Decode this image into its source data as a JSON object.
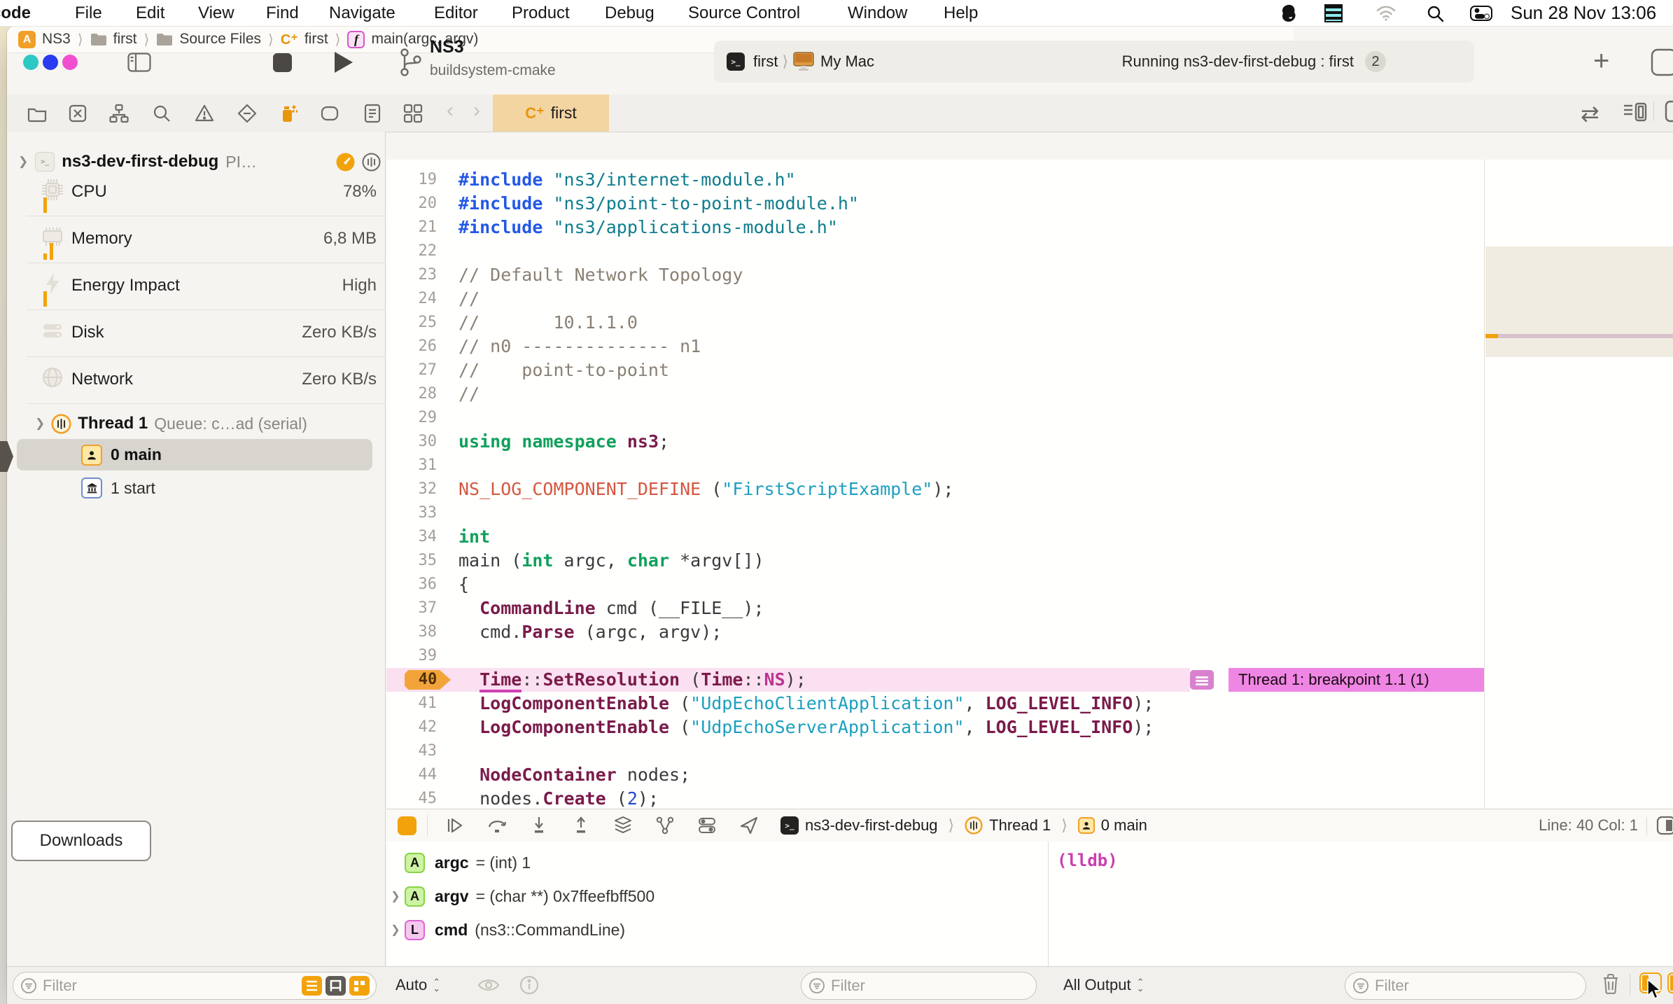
{
  "menu_bar": {
    "app": "Xcode",
    "items": [
      "File",
      "Edit",
      "View",
      "Find",
      "Navigate",
      "Editor",
      "Product",
      "Debug",
      "Source Control",
      "Window",
      "Help"
    ],
    "clock": "Sun 28 Nov 13:06"
  },
  "toolbar": {
    "project": "NS3",
    "build_system": "buildsystem-cmake",
    "scheme": "first",
    "destination": "My Mac",
    "activity": "Running ns3-dev-first-debug : first",
    "activity_count": "2"
  },
  "tab_bar": {
    "active_tab": "first",
    "tab_icon": "C⁺"
  },
  "jump_bar": {
    "segments": [
      {
        "icon": "app",
        "label": "NS3"
      },
      {
        "icon": "folder",
        "label": "first"
      },
      {
        "icon": "folder",
        "label": "Source Files"
      },
      {
        "icon": "cpp",
        "label": "first"
      },
      {
        "icon": "func",
        "label": "main(argc, argv)"
      }
    ]
  },
  "navigator": {
    "process": {
      "name": "ns3-dev-first-debug",
      "pid": "PI…"
    },
    "gauges": [
      {
        "label": "CPU",
        "value": "78%",
        "icon": "cpu",
        "ticks": [
          22
        ]
      },
      {
        "label": "Memory",
        "value": "6,8 MB",
        "icon": "memory",
        "ticks": [
          9,
          24
        ]
      },
      {
        "label": "Energy Impact",
        "value": "High",
        "icon": "energy",
        "ticks": [
          22
        ]
      },
      {
        "label": "Disk",
        "value": "Zero KB/s",
        "icon": "disk",
        "ticks": []
      },
      {
        "label": "Network",
        "value": "Zero KB/s",
        "icon": "network",
        "ticks": []
      }
    ],
    "thread": {
      "name": "Thread 1",
      "queue": "Queue: c…ad (serial)",
      "frames": [
        {
          "icon": "person",
          "label": "0 main",
          "selected": true
        },
        {
          "icon": "bank",
          "label": "1 start",
          "selected": false
        }
      ]
    },
    "downloads": "Downloads",
    "filter_placeholder": "Filter"
  },
  "editor": {
    "breakpoint": {
      "line": "40",
      "banner": "Thread 1: breakpoint 1.1 (1)"
    },
    "lines": [
      {
        "n": "19",
        "t": [
          [
            "pp",
            "#include"
          ],
          [
            "pl",
            " "
          ],
          [
            "si",
            "\"ns3/internet-module.h\""
          ]
        ]
      },
      {
        "n": "20",
        "t": [
          [
            "pp",
            "#include"
          ],
          [
            "pl",
            " "
          ],
          [
            "si",
            "\"ns3/point-to-point-module.h\""
          ]
        ]
      },
      {
        "n": "21",
        "t": [
          [
            "pp",
            "#include"
          ],
          [
            "pl",
            " "
          ],
          [
            "si",
            "\"ns3/applications-module.h\""
          ]
        ]
      },
      {
        "n": "22",
        "t": []
      },
      {
        "n": "23",
        "t": [
          [
            "cm",
            "// Default Network Topology"
          ]
        ]
      },
      {
        "n": "24",
        "t": [
          [
            "cm",
            "//"
          ]
        ]
      },
      {
        "n": "25",
        "t": [
          [
            "cm",
            "//       10.1.1.0"
          ]
        ]
      },
      {
        "n": "26",
        "t": [
          [
            "cm",
            "// n0 -------------- n1"
          ]
        ]
      },
      {
        "n": "27",
        "t": [
          [
            "cm",
            "//    point-to-point"
          ]
        ]
      },
      {
        "n": "28",
        "t": [
          [
            "cm",
            "//"
          ]
        ]
      },
      {
        "n": "29",
        "t": []
      },
      {
        "n": "30",
        "t": [
          [
            "kw",
            "using"
          ],
          [
            "pl",
            " "
          ],
          [
            "kw",
            "namespace"
          ],
          [
            "pl",
            " "
          ],
          [
            "ty",
            "ns3"
          ],
          [
            "pl",
            ";"
          ]
        ]
      },
      {
        "n": "31",
        "t": []
      },
      {
        "n": "32",
        "t": [
          [
            "mc",
            "NS_LOG_COMPONENT_DEFINE"
          ],
          [
            "pl",
            " ("
          ],
          [
            "st",
            "\"FirstScriptExample\""
          ],
          [
            "pl",
            ");"
          ]
        ]
      },
      {
        "n": "33",
        "t": []
      },
      {
        "n": "34",
        "t": [
          [
            "kw",
            "int"
          ]
        ]
      },
      {
        "n": "35",
        "t": [
          [
            "pl",
            "main ("
          ],
          [
            "kw",
            "int"
          ],
          [
            "pl",
            " argc, "
          ],
          [
            "kw",
            "char"
          ],
          [
            "pl",
            " *argv[])"
          ]
        ]
      },
      {
        "n": "36",
        "t": [
          [
            "pl",
            "{"
          ]
        ]
      },
      {
        "n": "37",
        "t": [
          [
            "pl",
            "  "
          ],
          [
            "ty",
            "CommandLine"
          ],
          [
            "pl",
            " cmd (__FILE__);"
          ]
        ]
      },
      {
        "n": "38",
        "t": [
          [
            "pl",
            "  cmd."
          ],
          [
            "ty",
            "Parse"
          ],
          [
            "pl",
            " (argc, argv);"
          ]
        ]
      },
      {
        "n": "39",
        "t": []
      },
      {
        "n": "40",
        "bp": true,
        "t": [
          [
            "pl",
            "  "
          ],
          [
            "tyu",
            "Time"
          ],
          [
            "pl",
            "::"
          ],
          [
            "ty",
            "SetResolution"
          ],
          [
            "pl",
            " ("
          ],
          [
            "ty",
            "Time"
          ],
          [
            "pl",
            "::"
          ],
          [
            "en",
            "NS"
          ],
          [
            "pl",
            ");"
          ]
        ]
      },
      {
        "n": "41",
        "t": [
          [
            "pl",
            "  "
          ],
          [
            "ty",
            "LogComponentEnable"
          ],
          [
            "pl",
            " ("
          ],
          [
            "st",
            "\"UdpEchoClientApplication\""
          ],
          [
            "pl",
            ", "
          ],
          [
            "ty",
            "LOG_LEVEL_INFO"
          ],
          [
            "pl",
            ");"
          ]
        ]
      },
      {
        "n": "42",
        "t": [
          [
            "pl",
            "  "
          ],
          [
            "ty",
            "LogComponentEnable"
          ],
          [
            "pl",
            " ("
          ],
          [
            "st",
            "\"UdpEchoServerApplication\""
          ],
          [
            "pl",
            ", "
          ],
          [
            "ty",
            "LOG_LEVEL_INFO"
          ],
          [
            "pl",
            ");"
          ]
        ]
      },
      {
        "n": "43",
        "t": []
      },
      {
        "n": "44",
        "t": [
          [
            "pl",
            "  "
          ],
          [
            "ty",
            "NodeContainer"
          ],
          [
            "pl",
            " nodes;"
          ]
        ]
      },
      {
        "n": "45",
        "t": [
          [
            "pl",
            "  nodes."
          ],
          [
            "ty",
            "Create"
          ],
          [
            "pl",
            " ("
          ],
          [
            "nu",
            "2"
          ],
          [
            "pl",
            ");"
          ]
        ]
      }
    ]
  },
  "debug_bar": {
    "process": "ns3-dev-first-debug",
    "thread": "Thread 1",
    "frame": "0 main",
    "line_col": "Line: 40  Col: 1"
  },
  "variables": {
    "rows": [
      {
        "badge": "A",
        "kind": "arg",
        "name": "argc",
        "detail": "= (int) 1",
        "expandable": false
      },
      {
        "badge": "A",
        "kind": "arg",
        "name": "argv",
        "detail": "= (char **) 0x7ffeefbff500",
        "expandable": true
      },
      {
        "badge": "L",
        "kind": "local",
        "name": "cmd",
        "detail": "(ns3::CommandLine)",
        "expandable": true
      }
    ],
    "scope": "Auto",
    "filter_placeholder": "Filter"
  },
  "console": {
    "prompt": "(lldb)",
    "output_scope": "All Output",
    "filter_placeholder": "Filter"
  }
}
